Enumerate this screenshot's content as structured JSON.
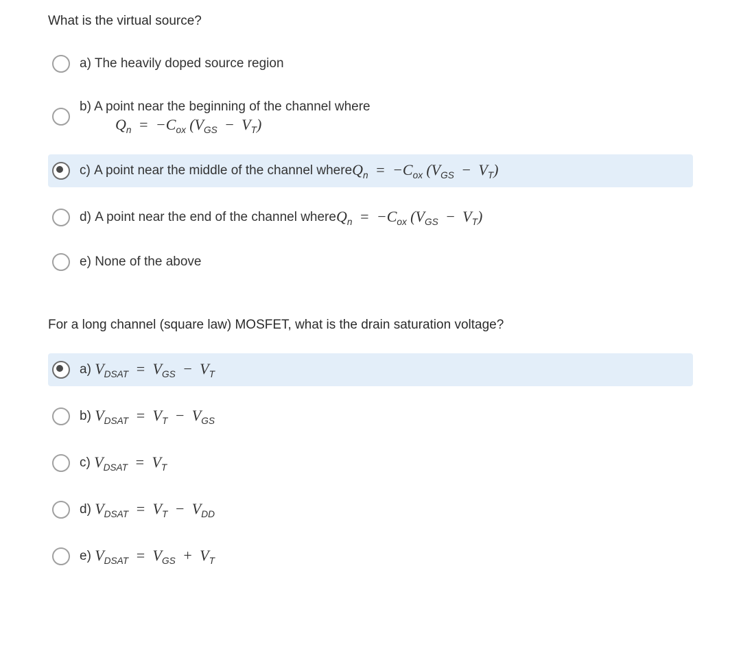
{
  "q1": {
    "prompt": "What is the virtual source?",
    "options": {
      "a_label": "a)",
      "a_text": "The heavily doped source region",
      "b_label": "b)",
      "b_text": "A point near the beginning of the channel where",
      "c_label": "c)",
      "c_text": "A point near the middle of the channel where ",
      "d_label": "d)",
      "d_text": "A point near the end of the channel where ",
      "e_label": "e)",
      "e_text": "None of the above"
    },
    "formula": {
      "Qn": "Q",
      "n": "n",
      "eq": "=",
      "neg": "−",
      "Cox_C": "C",
      "Cox_ox": "ox",
      "lp": "(",
      "V": "V",
      "GS": "GS",
      "minus": "−",
      "T": "T",
      "rp": ")"
    },
    "selected": "c"
  },
  "q2": {
    "prompt": "For a long channel (square law) MOSFET, what is the drain saturation voltage?",
    "labels": {
      "a": "a)",
      "b": "b)",
      "c": "c)",
      "d": "d)",
      "e": "e)"
    },
    "formula": {
      "V": "V",
      "DSAT": "DSAT",
      "eq": "=",
      "GS": "GS",
      "minus": "−",
      "plus": "+",
      "T": "T",
      "DD": "DD"
    },
    "selected": "a"
  }
}
